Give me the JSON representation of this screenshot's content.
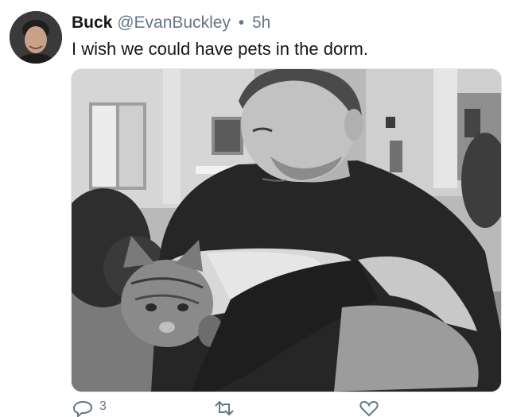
{
  "tweet": {
    "author_name": "Buck",
    "handle": "@EvanBuckley",
    "separator": "•",
    "time": "5h",
    "text": "I wish we could have pets in the dorm.",
    "reply_count": "3"
  },
  "icons": {
    "reply": "reply-icon",
    "retweet": "retweet-icon",
    "like": "heart-icon"
  },
  "colors": {
    "text": "#14171a",
    "secondary": "#657786",
    "border": "#e1e8ed"
  }
}
